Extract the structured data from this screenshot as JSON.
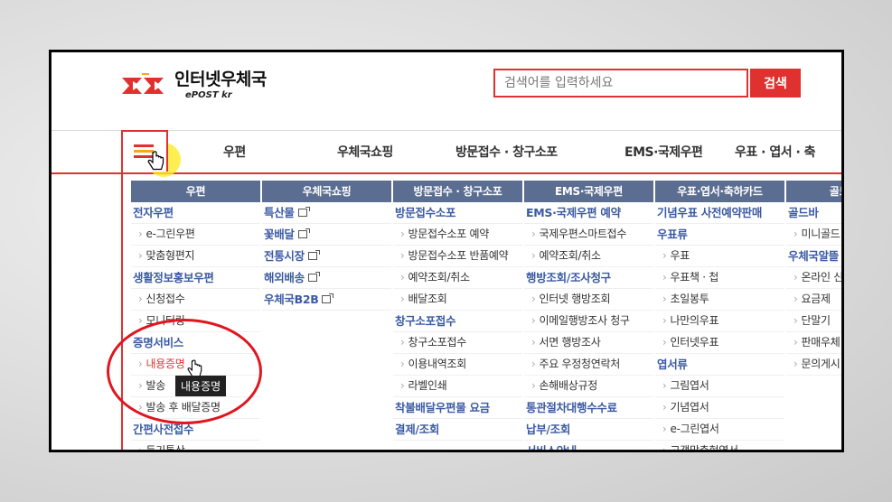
{
  "header": {
    "logo_ko": "인터넷우체국",
    "logo_en": "ePOST kr",
    "search_placeholder": "검색어를 입력하세요",
    "search_button": "검색"
  },
  "nav": {
    "items": [
      "우편",
      "우체국쇼핑",
      "방문접수 · 창구소포",
      "EMS·국제우편",
      "우표 · 엽서 · 축"
    ]
  },
  "columns": [
    {
      "head": "우편",
      "entries": [
        {
          "t": "group",
          "label": "전자우편"
        },
        {
          "t": "sub",
          "label": "e-그린우편"
        },
        {
          "t": "sub",
          "label": "맞춤형편지"
        },
        {
          "t": "group",
          "label": "생활정보홍보우편"
        },
        {
          "t": "sub",
          "label": "신청접수"
        },
        {
          "t": "sub",
          "label": "모니터링"
        },
        {
          "t": "group",
          "label": "증명서비스"
        },
        {
          "t": "sub",
          "label": "내용증명",
          "red": true
        },
        {
          "t": "sub",
          "label": "발송"
        },
        {
          "t": "sub",
          "label": "발송 후 배달증명"
        },
        {
          "t": "group",
          "label": "간편사전접수"
        },
        {
          "t": "sub",
          "label": "등기통상"
        }
      ]
    },
    {
      "head": "우체국쇼핑",
      "entries": [
        {
          "t": "group",
          "label": "특산물",
          "ext": true
        },
        {
          "t": "group",
          "label": "꽃배달",
          "ext": true
        },
        {
          "t": "group",
          "label": "전통시장",
          "ext": true
        },
        {
          "t": "group",
          "label": "해외배송",
          "ext": true
        },
        {
          "t": "group",
          "label": "우체국B2B",
          "ext": true
        }
      ]
    },
    {
      "head": "방문접수 · 창구소포",
      "entries": [
        {
          "t": "group",
          "label": "방문접수소포"
        },
        {
          "t": "sub",
          "label": "방문접수소포 예약"
        },
        {
          "t": "sub",
          "label": "방문접수소포 반품예약",
          "tall": true
        },
        {
          "t": "sub",
          "label": "예약조회/취소"
        },
        {
          "t": "sub",
          "label": "배달조회"
        },
        {
          "t": "group",
          "label": "창구소포접수"
        },
        {
          "t": "sub",
          "label": "창구소포접수"
        },
        {
          "t": "sub",
          "label": "이용내역조회"
        },
        {
          "t": "sub",
          "label": "라벨인쇄"
        },
        {
          "t": "group",
          "label": "착불배달우편물 요금"
        },
        {
          "t": "group",
          "label": "결제/조회"
        }
      ]
    },
    {
      "head": "EMS·국제우편",
      "entries": [
        {
          "t": "group",
          "label": "EMS·국제우편 예약"
        },
        {
          "t": "sub",
          "label": "국제우편스마트접수"
        },
        {
          "t": "sub",
          "label": "예약조회/취소"
        },
        {
          "t": "group",
          "label": "행방조회/조사청구"
        },
        {
          "t": "sub",
          "label": "인터넷 행방조회"
        },
        {
          "t": "sub",
          "label": "이메일행방조사 청구"
        },
        {
          "t": "sub",
          "label": "서면 행방조사"
        },
        {
          "t": "sub",
          "label": "주요 우정청연락처"
        },
        {
          "t": "sub",
          "label": "손해배상규정"
        },
        {
          "t": "group",
          "label": "통관절차대행수수료"
        },
        {
          "t": "group",
          "label": "납부/조회"
        },
        {
          "t": "group",
          "label": "서비스안내"
        }
      ]
    },
    {
      "head": "우표·엽서·축하카드",
      "entries": [
        {
          "t": "group",
          "label": "기념우표 사전예약판매"
        },
        {
          "t": "group",
          "label": "우표류"
        },
        {
          "t": "sub",
          "label": "우표"
        },
        {
          "t": "sub",
          "label": "우표책 · 첩"
        },
        {
          "t": "sub",
          "label": "초일봉투"
        },
        {
          "t": "sub",
          "label": "나만의우표"
        },
        {
          "t": "sub",
          "label": "인터넷우표"
        },
        {
          "t": "group",
          "label": "엽서류"
        },
        {
          "t": "sub",
          "label": "그림엽서"
        },
        {
          "t": "sub",
          "label": "기념엽서"
        },
        {
          "t": "sub",
          "label": "e-그린엽서"
        },
        {
          "t": "sub",
          "label": "고객맞춤형엽서"
        }
      ]
    },
    {
      "head": "골드바·우",
      "entries": [
        {
          "t": "group",
          "label": "골드바"
        },
        {
          "t": "sub",
          "label": "미니골드"
        },
        {
          "t": "group",
          "label": "우체국알뜰"
        },
        {
          "t": "sub",
          "label": "온라인 신"
        },
        {
          "t": "sub",
          "label": "요금제"
        },
        {
          "t": "sub",
          "label": "단말기"
        },
        {
          "t": "sub",
          "label": "판매우체"
        },
        {
          "t": "sub",
          "label": "문의게시"
        }
      ]
    }
  ],
  "tooltip": "내용증명",
  "colors": {
    "accent": "#e03131",
    "column_head": "#5b6e91",
    "group_text": "#3b5aa3",
    "annotation": "#e0151f",
    "highlight": "#ffeb28"
  }
}
